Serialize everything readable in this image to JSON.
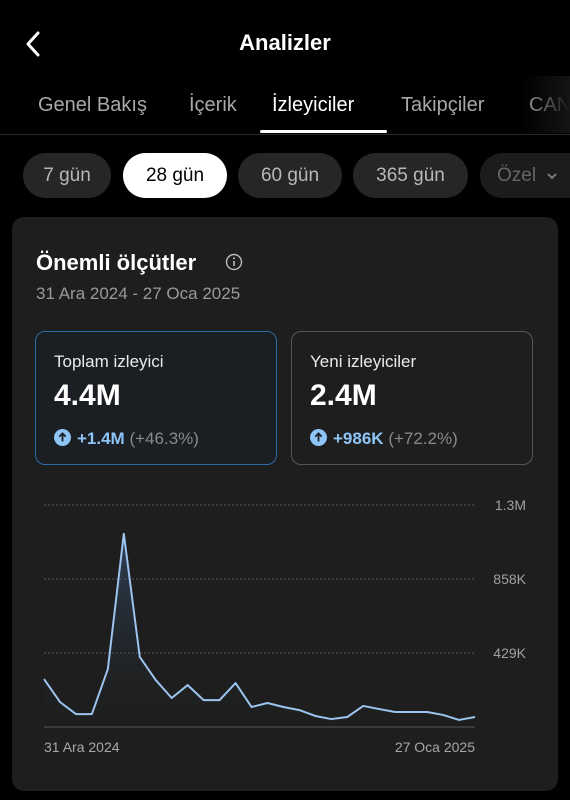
{
  "header": {
    "title": "Analizler",
    "back_icon": "chevron-left-icon"
  },
  "tabs": [
    {
      "label": "Genel Bakış",
      "active": false
    },
    {
      "label": "İçerik",
      "active": false
    },
    {
      "label": "İzleyiciler",
      "active": true
    },
    {
      "label": "Takipçiler",
      "active": false
    },
    {
      "label": "CAN",
      "active": false
    }
  ],
  "date_chips": [
    {
      "label": "7 gün",
      "active": false
    },
    {
      "label": "28 gün",
      "active": true
    },
    {
      "label": "60 gün",
      "active": false
    },
    {
      "label": "365 gün",
      "active": false
    },
    {
      "label": "Özel",
      "active": false,
      "has_dropdown": true
    }
  ],
  "card": {
    "title": "Önemli ölçütler",
    "info_icon": "info-icon",
    "date_range": "31 Ara 2024 - 27 Oca 2025",
    "metrics": [
      {
        "label": "Toplam izleyici",
        "value": "4.4M",
        "delta": "+1.4M",
        "delta_pct": "(+46.3%)",
        "selected": true
      },
      {
        "label": "Yeni izleyiciler",
        "value": "2.4M",
        "delta": "+986K",
        "delta_pct": "(+72.2%)",
        "selected": false
      }
    ]
  },
  "colors": {
    "accent": "#8ec5f7",
    "line": "#9cc4ef",
    "selected_border": "#2d6aa3"
  },
  "chart_data": {
    "type": "area",
    "title": "",
    "xlabel": "",
    "ylabel": "",
    "x_tick_labels": [
      "31 Ara 2024",
      "27 Oca 2025"
    ],
    "y_tick_labels": [
      "429K",
      "858K",
      "1.3M"
    ],
    "y_ticks": [
      429000,
      858000,
      1287000
    ],
    "ylim": [
      0,
      1287000
    ],
    "grid": true,
    "series": [
      {
        "name": "Toplam izleyici",
        "values": [
          278000,
          145000,
          75000,
          75000,
          336000,
          1120000,
          406000,
          272000,
          168000,
          243000,
          156000,
          156000,
          255000,
          116000,
          139000,
          116000,
          98000,
          64000,
          46000,
          58000,
          122000,
          104000,
          87000,
          87000,
          87000,
          70000,
          41000,
          58000
        ]
      }
    ]
  }
}
